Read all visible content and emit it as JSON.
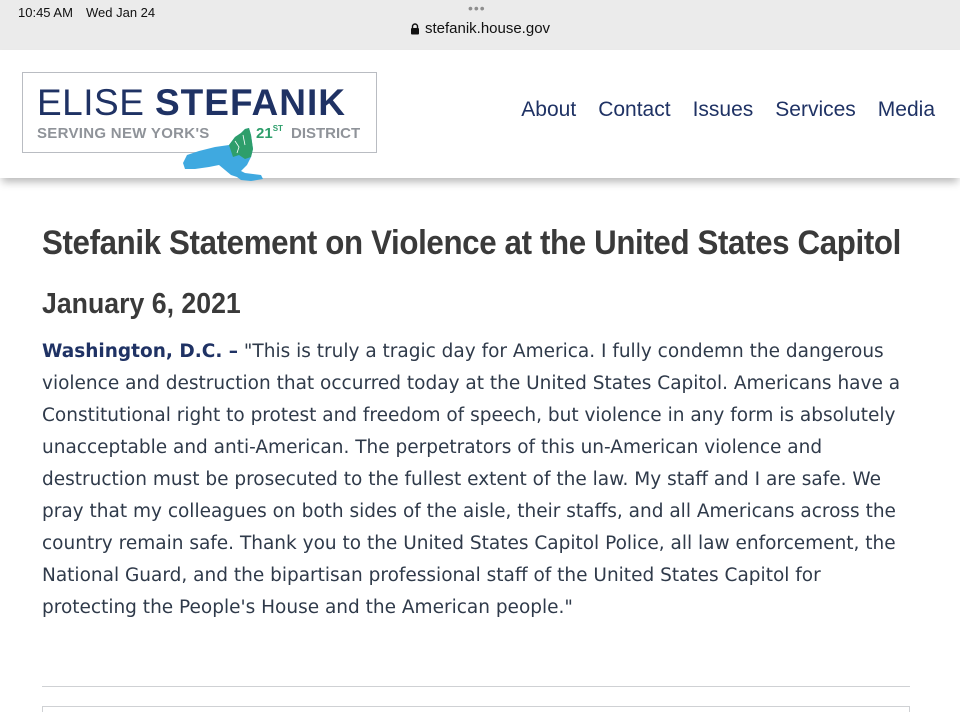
{
  "status": {
    "time": "10:45 AM",
    "date": "Wed Jan 24"
  },
  "browser": {
    "url": "stefanik.house.gov",
    "lock_icon": "lock-icon",
    "tab_dots": "•••"
  },
  "logo": {
    "first_name": "ELISE",
    "last_name": "STEFANIK",
    "tagline": "SERVING NEW YORK'S",
    "district_number": "21",
    "district_suffix": "ST",
    "district_word": "DISTRICT",
    "map_icon": "new-york-map-icon"
  },
  "nav": {
    "items": [
      "About",
      "Contact",
      "Issues",
      "Services",
      "Media"
    ]
  },
  "article": {
    "title": "Stefanik Statement on Violence at the United States Capitol",
    "date": "January 6, 2021",
    "dateline": "Washington, D.C. –",
    "body": " \"This is truly a tragic day for America. I fully condemn the dangerous violence and destruction that occurred today at the United States Capitol. Americans have a Constitutional right to protest and freedom of speech, but violence in any form is absolutely unacceptable and anti-American. The perpetrators of this un-American violence and destruction must be prosecuted to the fullest extent of the law. My staff and I are safe. We pray that my colleagues on both sides of the aisle, their staffs, and all Americans across the country remain safe. Thank you to the United States Capitol Police, all law enforcement, the National Guard, and the bipartisan professional staff of the United States Capitol for protecting the People's House and the American people.\""
  },
  "colors": {
    "brand_navy": "#1f3264",
    "brand_green": "#2e9e6b",
    "map_blue": "#3fa9e0",
    "tag_gray": "#8f9399"
  }
}
